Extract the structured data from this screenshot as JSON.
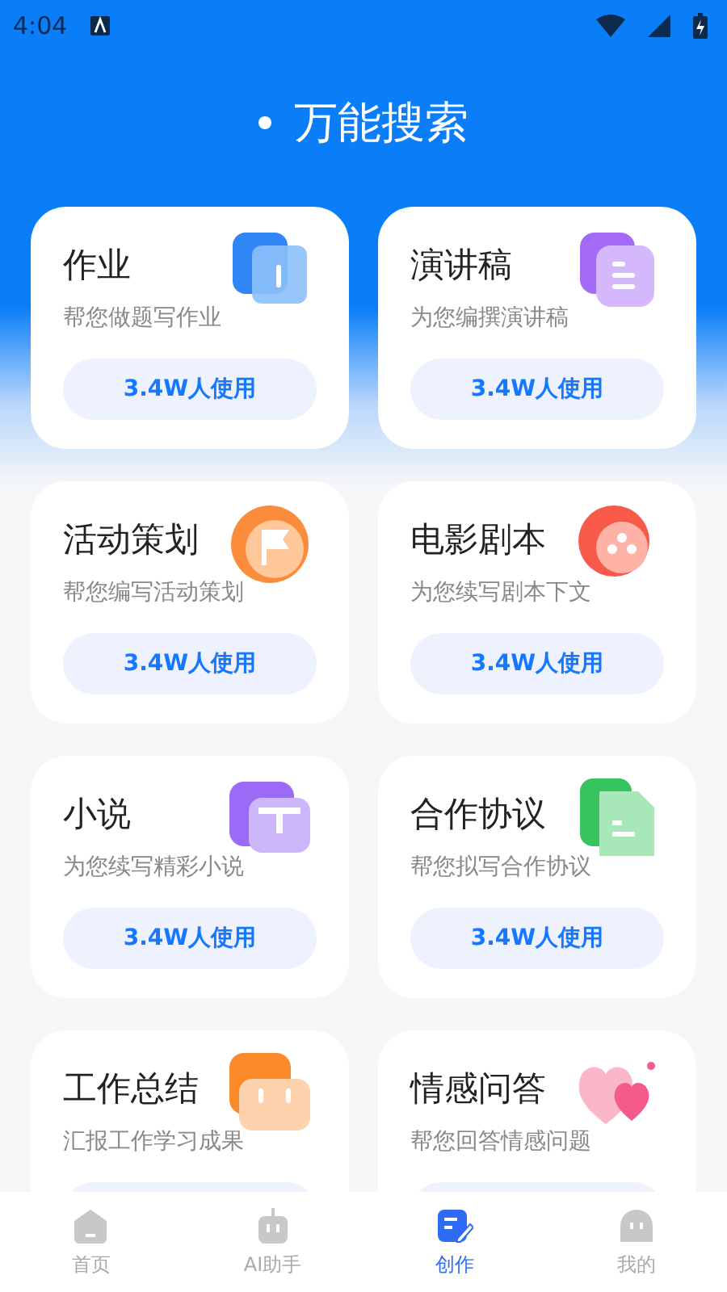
{
  "status_bar": {
    "time": "4:04"
  },
  "title": "万能搜索",
  "cards": [
    {
      "kind": "book",
      "title": "作业",
      "subtitle": "帮您做题写作业",
      "usage": "3.4W人使用"
    },
    {
      "kind": "notes",
      "title": "演讲稿",
      "subtitle": "为您编撰演讲稿",
      "usage": "3.4W人使用"
    },
    {
      "kind": "flag",
      "title": "活动策划",
      "subtitle": "帮您编写活动策划",
      "usage": "3.4W人使用"
    },
    {
      "kind": "film",
      "title": "电影剧本",
      "subtitle": "为您续写剧本下文",
      "usage": "3.4W人使用"
    },
    {
      "kind": "board",
      "title": "小说",
      "subtitle": "为您续写精彩小说",
      "usage": "3.4W人使用"
    },
    {
      "kind": "file",
      "title": "合作协议",
      "subtitle": "帮您拟写合作协议",
      "usage": "3.4W人使用"
    },
    {
      "kind": "briefcase",
      "title": "工作总结",
      "subtitle": "汇报工作学习成果"
    },
    {
      "kind": "heart",
      "title": "情感问答",
      "subtitle": "帮您回答情感问题"
    }
  ],
  "nav": [
    {
      "kind": "home",
      "label": "首页",
      "selected": false
    },
    {
      "kind": "robot",
      "label": "AI助手",
      "selected": false
    },
    {
      "kind": "write",
      "label": "创作",
      "selected": true
    },
    {
      "kind": "user",
      "label": "我的",
      "selected": false
    }
  ]
}
